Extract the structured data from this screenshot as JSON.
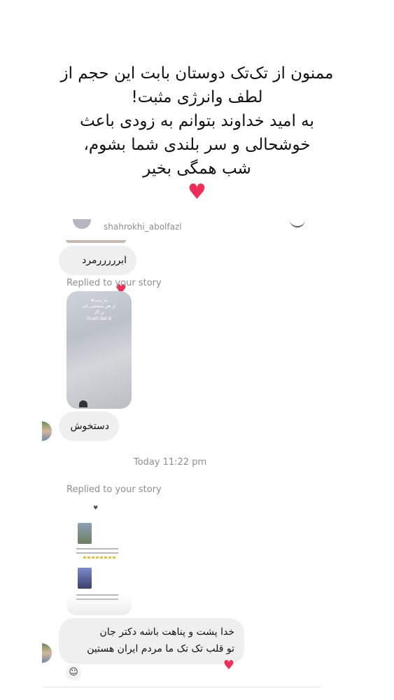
{
  "caption": {
    "lines": [
      "ممنون از تک‌تک دوستان بابت این حجم از",
      "لطف وانرژی مثبت!",
      "به امید خداوند بتوانم به زودی باعث",
      "خوشحالی و سر بلندی شما بشوم،",
      "شب همگی بخیر"
    ],
    "heart": "♥"
  },
  "chat": {
    "top_username": "shahrokhi_abolfazl",
    "message1": {
      "text": "ابرررررمرد",
      "emoji": "♥"
    },
    "replied_label_1": "Replied to your story",
    "story1_text": [
      "#ما_بخند",
      "از هنر منبعشی نان",
      "پر اگر",
      "Finalli Baf B"
    ],
    "message2": {
      "text": "دستخوش"
    },
    "timestamp": "Today 11:22 pm",
    "replied_label_2": "Replied to your story",
    "story2_header": "♥",
    "message3": {
      "line1": "خدا پشت و پناهت باشه دکتر جان",
      "line2": "تو قلب تک تک ما مردم ایران هستین",
      "emoji": "♥"
    },
    "reaction": "☺"
  }
}
